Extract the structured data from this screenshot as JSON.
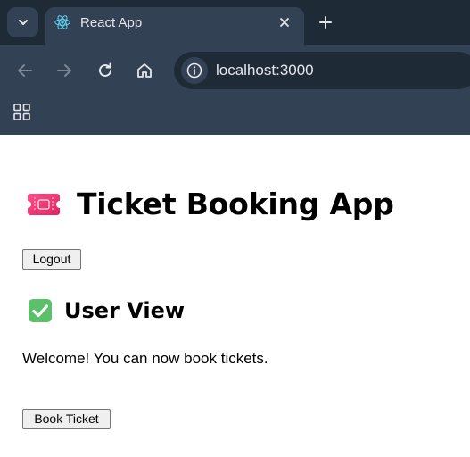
{
  "browser": {
    "tab": {
      "title": "React App",
      "favicon": "react-logo-icon"
    },
    "address_bar": {
      "url": "localhost:3000"
    },
    "icons": {
      "tab_search": "chevron-down-icon",
      "close_tab": "close-icon",
      "new_tab": "plus-icon",
      "back": "arrow-left-icon",
      "forward": "arrow-right-icon",
      "reload": "reload-icon",
      "home": "home-icon",
      "site_info": "info-icon",
      "apps": "apps-grid-icon"
    },
    "colors": {
      "tabstrip": "#1f2a37",
      "toolbar": "#334155",
      "text": "#e5e7eb"
    }
  },
  "page": {
    "title": "Ticket Booking App",
    "title_emoji": "ticket-icon",
    "logout_label": "Logout",
    "section_heading": "User View",
    "section_emoji": "check-mark-icon",
    "welcome_text": "Welcome! You can now book tickets.",
    "book_label": "Book Ticket"
  }
}
